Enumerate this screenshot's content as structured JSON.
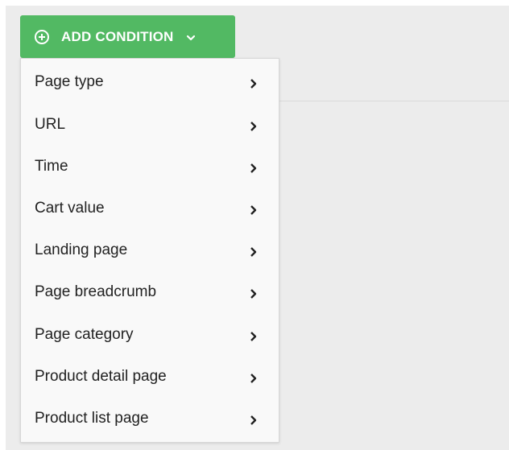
{
  "toolbar": {
    "add_condition_label": "ADD CONDITION"
  },
  "icons": {
    "add": "plus-circle-icon",
    "dropdown": "chevron-down-icon",
    "submenu": "chevron-right-icon"
  },
  "colors": {
    "button_bg": "#52b963",
    "menu_bg": "#f9f9f9",
    "panel_bg": "#ececec"
  },
  "menu": {
    "items": [
      {
        "label": "Page type"
      },
      {
        "label": "URL"
      },
      {
        "label": "Time"
      },
      {
        "label": "Cart value"
      },
      {
        "label": "Landing page"
      },
      {
        "label": "Page breadcrumb"
      },
      {
        "label": "Page category"
      },
      {
        "label": "Product detail page"
      },
      {
        "label": "Product list page"
      }
    ]
  }
}
